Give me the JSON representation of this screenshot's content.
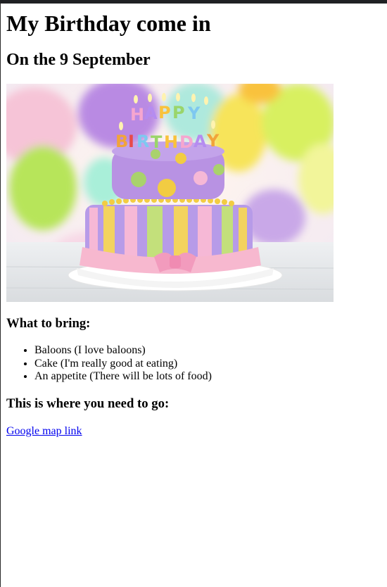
{
  "page": {
    "title": "My Birthday come in",
    "subtitle": "On the 9 September"
  },
  "image": {
    "alt": "Birthday cake",
    "cake_topper_text": "HAPPY BIRTHDAY"
  },
  "bring": {
    "heading": "What to bring:",
    "items": [
      "Baloons (I love baloons)",
      "Cake (I'm really good at eating)",
      "An appetite (There will be lots of food)"
    ]
  },
  "directions": {
    "heading": "This is where you need to go:",
    "link_text": "Google map link"
  }
}
